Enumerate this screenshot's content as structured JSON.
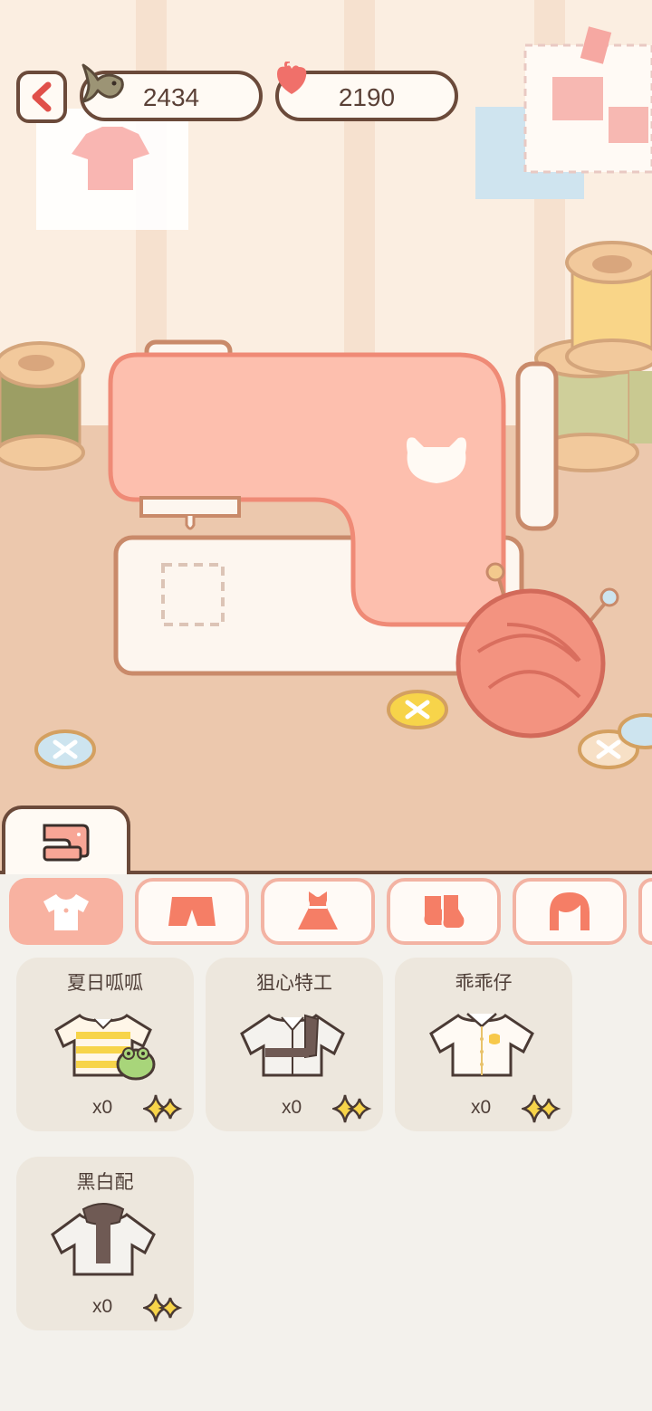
{
  "hud": {
    "back_icon": "chevron-left-icon",
    "fish": {
      "icon": "fish-icon",
      "value": "2434"
    },
    "yarn": {
      "icon": "yarn-heart-icon",
      "value": "2190"
    }
  },
  "scene": {
    "machine_tab_icon": "sewing-machine-icon"
  },
  "categories": [
    {
      "icon": "shirt-icon",
      "active": true
    },
    {
      "icon": "shorts-icon",
      "active": false
    },
    {
      "icon": "dress-icon",
      "active": false
    },
    {
      "icon": "socks-icon",
      "active": false
    },
    {
      "icon": "hair-icon",
      "active": false
    }
  ],
  "items": [
    {
      "name": "夏日呱呱",
      "count": "x0",
      "art": "striped-frog-shirt",
      "star": "sparkle-icon"
    },
    {
      "name": "狙心特工",
      "count": "x0",
      "art": "agent-jacket",
      "star": "sparkle-icon"
    },
    {
      "name": "乖乖仔",
      "count": "x0",
      "art": "white-shirt",
      "star": "sparkle-icon"
    },
    {
      "name": "黑白配",
      "count": "x0",
      "art": "hoodie-jacket",
      "star": "sparkle-icon"
    }
  ],
  "colors": {
    "outline": "#6b4a3a",
    "accent": "#f8b2a1",
    "machine": "#fdbfae",
    "star": "#f7d44a"
  }
}
